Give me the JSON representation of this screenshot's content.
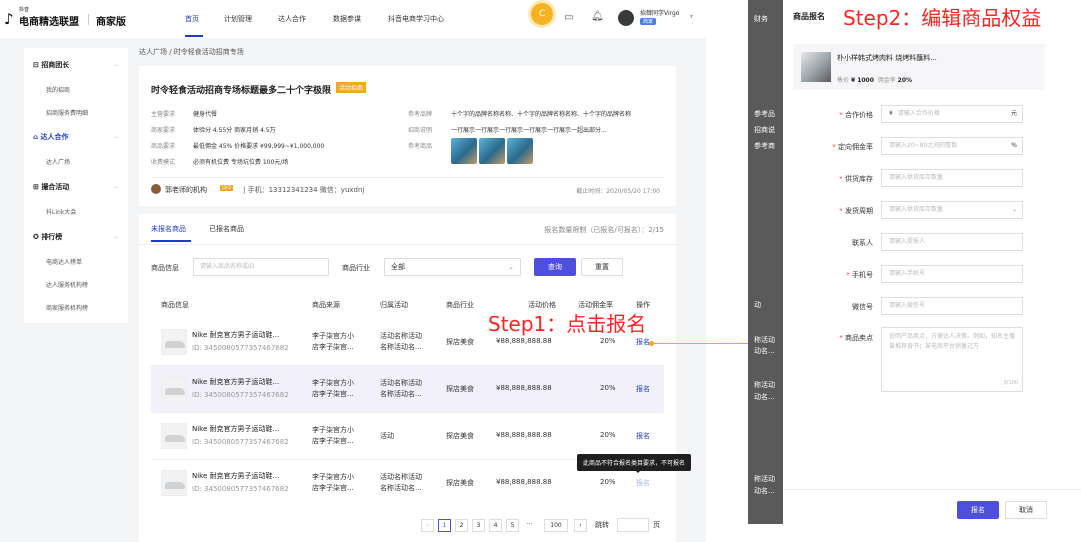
{
  "brand": {
    "small": "抖音",
    "name": "电商精选联盟",
    "sub": "商家版"
  },
  "nav": {
    "items": [
      "首页",
      "计划管理",
      "达人合作",
      "数据参谋",
      "抖音电商学习中心"
    ]
  },
  "user": {
    "badge": "C",
    "name": "抬肆同学Virgo",
    "role": "商家"
  },
  "sidebar": {
    "sections": [
      {
        "label": "招商团长",
        "items": [
          "我的招商",
          "招商服务费明细"
        ]
      },
      {
        "label": "达人合作",
        "items": [
          "达人广场"
        ]
      },
      {
        "label": "撮合活动",
        "items": [
          "抖Link大会"
        ]
      },
      {
        "label": "排行榜",
        "items": [
          "电商达人榜单",
          "达人服务机构榜",
          "商家服务机构榜"
        ]
      }
    ]
  },
  "breadcrumb": "达人广场 / 时令轻食活动招商专场",
  "campaign": {
    "title": "时令轻食活动招商专场标题最多二十个字极限",
    "tag": "活动招商",
    "left_keys": [
      "主营要求",
      "商家要求",
      "商品要求",
      "收费模式"
    ],
    "left_vals": [
      "健身代餐",
      "体验分 4.55分    商家月销 4.5万",
      "最低佣金 45%    价格要求 ¥99,999~¥1,000,000",
      "必须有机位费 专场坑位费 100元/场"
    ],
    "right_keys": [
      "参考品牌",
      "招商说明",
      "参考商品"
    ],
    "right_vals": [
      "十个字的品牌名称名称、十个字的品牌名称名称、十个字的品牌名称",
      "一行展示一行展示一行展示一行展示一行展示一超出部分..."
    ],
    "org": "郭老师的机构",
    "org_level": "LV3",
    "contact": "|   手机：13312341234   微信：yuxdnj",
    "deadline": "截止时间：2020/05/20 17:00"
  },
  "tabs": {
    "unsigned": "未报名商品",
    "signed": "已报名商品",
    "quota": "报名数量限制（已报名/可报名）：2/15"
  },
  "filter": {
    "info_label": "商品信息",
    "info_placeholder": "请输入商品名称或ID",
    "industry_label": "商品行业",
    "industry_value": "全部",
    "query": "查询",
    "reset": "重置"
  },
  "table": {
    "headers": [
      "商品信息",
      "商品来源",
      "归属活动",
      "商品行业",
      "活动价格",
      "活动佣金率",
      "操作"
    ],
    "rows": [
      {
        "name": "Nike 耐克官方男子运动鞋...",
        "id": "ID: 3450080577357467682",
        "src1": "李子柒官方小",
        "src2": "店李子柒官...",
        "act1": "活动名称活动",
        "act2": "名称活动名...",
        "industry": "探店美食",
        "price": "¥88,888,888.88",
        "rate": "20%",
        "op": "报名"
      },
      {
        "name": "Nike 耐克官方男子运动鞋...",
        "id": "ID: 3450080577357467682",
        "src1": "李子柒官方小",
        "src2": "店李子柒官...",
        "act1": "活动名称活动",
        "act2": "名称活动名...",
        "industry": "探店美食",
        "price": "¥88,888,888.88",
        "rate": "20%",
        "op": "报名"
      },
      {
        "name": "Nike 耐克官方男子运动鞋...",
        "id": "ID: 3450080577357467682",
        "src1": "李子柒官方小",
        "src2": "店李子柒官...",
        "act1": "活动",
        "act2": "",
        "industry": "探店美食",
        "price": "¥88,888,888.88",
        "rate": "20%",
        "op": "报名"
      },
      {
        "name": "Nike 耐克官方男子运动鞋...",
        "id": "ID: 3450080577357467682",
        "src1": "李子柒官方小",
        "src2": "店李子柒官...",
        "act1": "活动名称活动",
        "act2": "名称活动名...",
        "industry": "探店美食",
        "price": "¥88,888,888.88",
        "rate": "20%",
        "op": "报名"
      }
    ],
    "tooltip": "此商品不符合报名类目要求，不可报名"
  },
  "pagination": {
    "pages": [
      "1",
      "2",
      "3",
      "4",
      "5",
      "···",
      "100"
    ],
    "jump": "跳转",
    "page_unit": "页"
  },
  "annotations": {
    "step1": "Step1：点击报名",
    "step2": "Step2：编辑商品权益"
  },
  "backdrop": {
    "labels": [
      "财务",
      "参考品",
      "招商说",
      "参考商",
      "动",
      "称活动",
      "动名...",
      "称活动",
      "动名...",
      "称活动",
      "动名..."
    ]
  },
  "drawer": {
    "title": "商品报名",
    "product_name": "朴小样韩式烤肉料 烧烤料蘸料...",
    "product_price_label": "售价",
    "product_price": "¥ 1000",
    "product_rate_label": "佣金率",
    "product_rate": "20%",
    "fields": [
      {
        "label": "合作价格",
        "required": true,
        "prefix": "¥",
        "placeholder": "请输入合作价格",
        "suffix": "元"
      },
      {
        "label": "定向佣金率",
        "required": true,
        "prefix": "",
        "placeholder": "请输入20~80之间的整数",
        "suffix": "%"
      },
      {
        "label": "供货库存",
        "required": true,
        "prefix": "",
        "placeholder": "请输入供货库存数量",
        "suffix": ""
      },
      {
        "label": "发货周期",
        "required": true,
        "prefix": "",
        "placeholder": "请输入供货库存数量",
        "suffix": "⌄"
      },
      {
        "label": "联系人",
        "required": false,
        "prefix": "",
        "placeholder": "请输入提报人",
        "suffix": ""
      },
      {
        "label": "手机号",
        "required": true,
        "prefix": "",
        "placeholder": "请输入手机号",
        "suffix": ""
      },
      {
        "label": "微信号",
        "required": false,
        "prefix": "",
        "placeholder": "请输入微信号",
        "suffix": ""
      }
    ],
    "selling_point": {
      "label": "商品卖点",
      "placeholder": "说明产品卖点，方便达人决策。例如，知名主播曾推荐背书；某电商平台销量过万",
      "count": "0/100"
    },
    "submit": "报名",
    "cancel": "取消"
  },
  "colors": {
    "primary": "#4e4ee0",
    "nav_active": "#1e3cc8",
    "annotation": "#ff2222",
    "tag": "#f5a623"
  }
}
